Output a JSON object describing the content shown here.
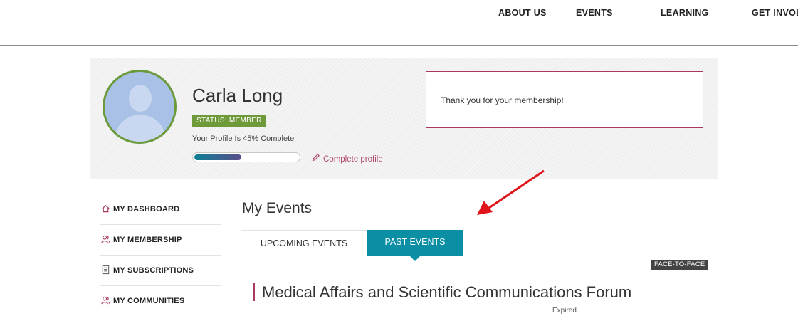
{
  "topnav": {
    "items": [
      "ABOUT US",
      "EVENTS",
      "LEARNING",
      "GET INVOLVED"
    ]
  },
  "profile": {
    "name": "Carla Long",
    "status": "STATUS: MEMBER",
    "completion_text": "Your Profile Is 45% Complete",
    "completion_fraction": 0.45,
    "complete_link": "Complete profile",
    "notice": "Thank you for your membership!"
  },
  "sidebar": {
    "items": [
      {
        "label": "MY DASHBOARD",
        "icon": "home-icon"
      },
      {
        "label": "MY MEMBERSHIP",
        "icon": "users-icon"
      },
      {
        "label": "MY SUBSCRIPTIONS",
        "icon": "document-icon"
      },
      {
        "label": "MY COMMUNITIES",
        "icon": "users-icon"
      }
    ]
  },
  "main": {
    "title": "My Events",
    "tabs": [
      {
        "label": "UPCOMING EVENTS",
        "active": false
      },
      {
        "label": "PAST EVENTS",
        "active": true
      }
    ],
    "event": {
      "badge": "FACE-TO-FACE",
      "title": "Medical Affairs and Scientific Communications Forum",
      "status": "Expired"
    }
  },
  "colors": {
    "accent_teal": "#0b8fa5",
    "accent_magenta": "#a8395e",
    "status_green": "#6f9a3a",
    "arrow_red": "#e0141b"
  }
}
